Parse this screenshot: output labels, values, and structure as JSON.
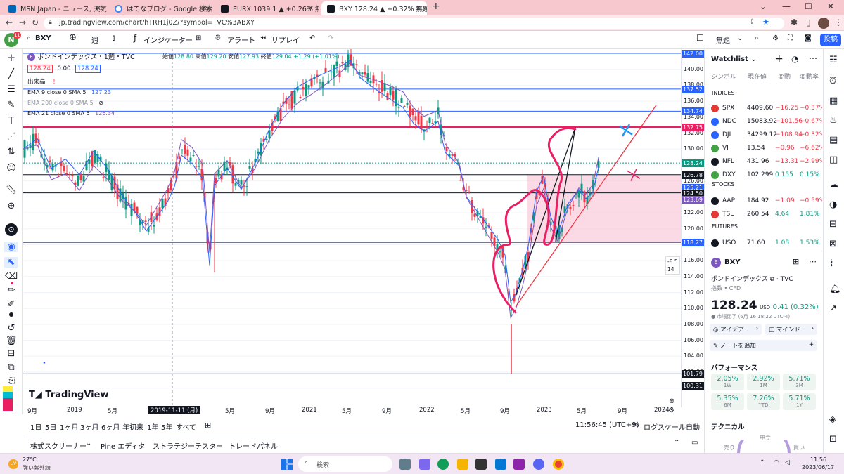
{
  "browser": {
    "tabs": [
      {
        "title": "MSN Japan - ニュース, 天気, メール",
        "active": false,
        "color": "#0067b8"
      },
      {
        "title": "はてなブログ - Google 検索",
        "active": false,
        "color": "#4285f4"
      },
      {
        "title": "EURX 1039.1 ▲ +0.26% 無題",
        "active": false,
        "color": "#131722"
      },
      {
        "title": "BXY 128.24 ▲ +0.32% 無題",
        "active": true,
        "color": "#131722"
      }
    ],
    "url": "jp.tradingview.com/chart/hTRH1j0Z/?symbol=TVC%3ABXY"
  },
  "toolbar": {
    "symbol": "BXY",
    "interval": "週",
    "indicators": "インジケーター",
    "alert": "アラート",
    "replay": "リプレイ",
    "layout_name": "無題",
    "publish": "投稿",
    "avatar_letter": "N",
    "avatar_badge": "11"
  },
  "chart": {
    "title": "ボンドインデックス・1週・TVC",
    "ohlc": {
      "open_label": "始値",
      "open": "128.80",
      "high_label": "高値",
      "high": "129.20",
      "low_label": "安値",
      "low": "127.93",
      "close_label": "終値",
      "close": "129.04",
      "change": "+1.29 (+1.01%)"
    },
    "bid": "128.24",
    "spread": "0.00",
    "ask": "128.24",
    "volume_label": "出来高",
    "indicators": [
      {
        "label": "EMA 9 close 0 SMA 5",
        "value": "127.23"
      },
      {
        "label": "EMA 200 close 0 SMA 5",
        "value": ""
      },
      {
        "label": "EMA 21 close 0 SMA 5",
        "value": "126.34"
      }
    ],
    "logo_text": "TradingView",
    "crosshair_date": "2019-11-11 (月)",
    "measure_values": [
      "-8.5",
      "14"
    ],
    "price_labels": [
      "142.00",
      "140.00",
      "138.00",
      "136.00",
      "134.00",
      "132.00",
      "130.00",
      "128.00",
      "126.00",
      "124.00",
      "122.00",
      "120.00",
      "118.00",
      "116.00",
      "114.00",
      "112.00",
      "110.00",
      "108.00",
      "106.00",
      "104.00",
      "102.00",
      "100.00"
    ],
    "level_tags": [
      {
        "value": "142.00",
        "color": "#2962ff"
      },
      {
        "value": "137.52",
        "color": "#2962ff"
      },
      {
        "value": "134.74",
        "color": "#2962ff"
      },
      {
        "value": "132.75",
        "color": "#e91e63"
      },
      {
        "value": "128.24",
        "color": "#089981"
      },
      {
        "value": "126.78",
        "color": "#131722"
      },
      {
        "value": "125.21",
        "color": "#2962ff"
      },
      {
        "value": "124.50",
        "color": "#131722"
      },
      {
        "value": "123.69",
        "color": "#7e57c2"
      },
      {
        "value": "118.27",
        "color": "#2962ff"
      },
      {
        "value": "101.79",
        "color": "#131722"
      },
      {
        "value": "100.31",
        "color": "#131722"
      }
    ],
    "time_labels": [
      "9月",
      "2019",
      "5月",
      "9月",
      "5月",
      "9月",
      "2021",
      "5月",
      "9月",
      "2022",
      "5月",
      "9月",
      "2023",
      "5月",
      "9月",
      "2024"
    ]
  },
  "bottom_bar": {
    "ranges": [
      "1日",
      "5日",
      "1ヶ月",
      "3ヶ月",
      "6ヶ月",
      "年初来",
      "1年",
      "5年",
      "すべて"
    ],
    "time": "11:56:45 (UTC+9)",
    "percent": "%",
    "log": "ログスケール",
    "auto": "自動"
  },
  "bottom_tabs": [
    "株式スクリーナー",
    "Pine エディタ",
    "ストラテジーテスター",
    "トレードパネル"
  ],
  "watchlist": {
    "title": "Watchlist",
    "columns": [
      "シンボル",
      "現在値",
      "変動",
      "変動率"
    ],
    "sections": [
      {
        "name": "INDICES",
        "items": [
          {
            "sym": "SPX",
            "price": "4409.60",
            "chg": "−16.25",
            "pct": "−0.37%",
            "up": false,
            "color": "#e53935"
          },
          {
            "sym": "NDC",
            "price": "15083.92",
            "chg": "−101.56",
            "pct": "−0.67%",
            "up": false,
            "color": "#2962ff"
          },
          {
            "sym": "DJI",
            "price": "34299.12",
            "chg": "−108.94",
            "pct": "−0.32%",
            "up": false,
            "color": "#2962ff"
          },
          {
            "sym": "VI",
            "price": "13.54",
            "chg": "−0.96",
            "pct": "−6.62%",
            "up": false,
            "color": "#43a047"
          },
          {
            "sym": "NFL",
            "price": "431.96",
            "chg": "−13.31",
            "pct": "−2.99%",
            "up": false,
            "color": "#131722"
          },
          {
            "sym": "DXY",
            "price": "102.299",
            "chg": "0.155",
            "pct": "0.15%",
            "up": true,
            "color": "#43a047"
          }
        ]
      },
      {
        "name": "STOCKS",
        "items": [
          {
            "sym": "AAP",
            "price": "184.92",
            "chg": "−1.09",
            "pct": "−0.59%",
            "up": false,
            "color": "#131722"
          },
          {
            "sym": "TSL",
            "price": "260.54",
            "chg": "4.64",
            "pct": "1.81%",
            "up": true,
            "color": "#e53935"
          }
        ]
      },
      {
        "name": "FUTURES",
        "items": [
          {
            "sym": "USO",
            "price": "71.60",
            "chg": "1.08",
            "pct": "1.53%",
            "up": true,
            "color": "#131722"
          }
        ]
      }
    ]
  },
  "details": {
    "symbol": "BXY",
    "name": "ボンドインデックス",
    "exchange": "TVC",
    "type": "指数 • CFD",
    "price": "128.24",
    "currency": "USD",
    "change": "0.41 (0.32%)",
    "status": "市場閉了",
    "status_time": "(6月 16 18:22 UTC-4)",
    "idea_btn": "アイデア",
    "mind_btn": "マインド",
    "note_btn": "ノートを追加",
    "perf_title": "パフォーマンス",
    "performance": [
      {
        "value": "2.05%",
        "period": "1W"
      },
      {
        "value": "2.92%",
        "period": "1M"
      },
      {
        "value": "5.71%",
        "period": "3M"
      },
      {
        "value": "5.35%",
        "period": "6M"
      },
      {
        "value": "7.26%",
        "period": "YTD"
      },
      {
        "value": "5.71%",
        "period": "1Y"
      }
    ],
    "tech_title": "テクニカル",
    "tech_neutral": "中立",
    "tech_sell": "売り",
    "tech_buy": "買い"
  },
  "taskbar": {
    "temp": "27°C",
    "weather": "強い紫外線",
    "search": "検索",
    "time": "11:56",
    "date": "2023/06/17",
    "uv": "UV"
  },
  "colors": {
    "up": "#089981",
    "down": "#f23645",
    "accent": "#2962ff",
    "annotation": "#e91e63"
  }
}
